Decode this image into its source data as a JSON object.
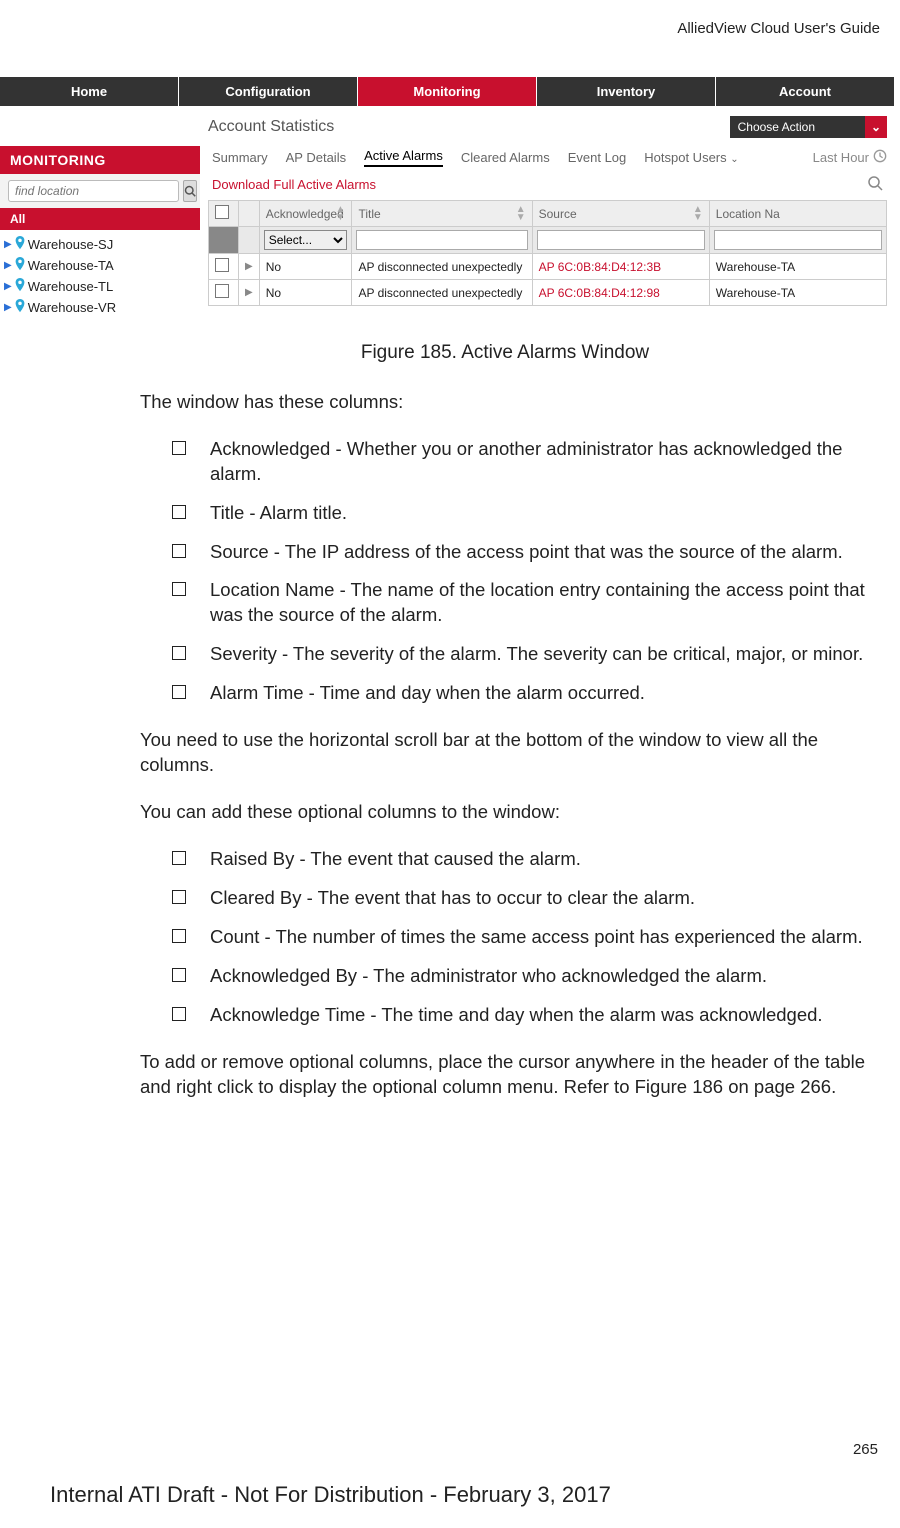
{
  "running_header": "AlliedView Cloud User's Guide",
  "ui": {
    "nav": {
      "home": "Home",
      "config": "Configuration",
      "monitoring": "Monitoring",
      "inventory": "Inventory",
      "account": "Account"
    },
    "acct_stats": "Account Statistics",
    "choose_action": "Choose Action",
    "left_panel": {
      "header": "MONITORING",
      "find_placeholder": "find location",
      "all_label": "All",
      "tree": [
        "Warehouse-SJ",
        "Warehouse-TA",
        "Warehouse-TL",
        "Warehouse-VR"
      ]
    },
    "tabs": {
      "summary": "Summary",
      "ap": "AP Details",
      "active": "Active Alarms",
      "cleared": "Cleared Alarms",
      "event": "Event Log",
      "hotspot": "Hotspot Users",
      "last_hour": "Last Hour"
    },
    "download_link": "Download Full Active Alarms",
    "table": {
      "hdr_ack": "Acknowledged",
      "hdr_title": "Title",
      "hdr_source": "Source",
      "hdr_loc": "Location Na",
      "filter_select": "Select...",
      "rows": [
        {
          "ack": "No",
          "title": "AP disconnected unexpectedly",
          "source": "AP 6C:0B:84:D4:12:3B",
          "loc": "Warehouse-TA"
        },
        {
          "ack": "No",
          "title": "AP disconnected unexpectedly",
          "source": "AP 6C:0B:84:D4:12:98",
          "loc": "Warehouse-TA"
        }
      ]
    }
  },
  "fig_caption": "Figure 185. Active Alarms Window",
  "doc": {
    "p1": "The window has these columns:",
    "cols": [
      "Acknowledged - Whether you or another administrator has acknowledged the alarm.",
      "Title - Alarm title.",
      "Source - The IP address of the access point that was the source of the alarm.",
      "Location Name - The name of the location entry containing the access point that was the source of the alarm.",
      "Severity - The severity of the alarm. The severity can be critical, major, or minor.",
      "Alarm Time - Time and day when the alarm occurred."
    ],
    "p2": "You need to use the horizontal scroll bar at the bottom of the window to view all the columns.",
    "p3": "You can add these optional columns to the window:",
    "opts": [
      "Raised By - The event that caused the alarm.",
      "Cleared By - The event that has to occur to clear the alarm.",
      "Count - The number of times the same access point has experienced the alarm.",
      "Acknowledged By - The administrator who acknowledged the alarm.",
      "Acknowledge Time - The time and day when the alarm was acknowledged."
    ],
    "p4": "To add or remove optional columns, place the cursor anywhere in the header of the table and right click to display the optional column menu. Refer to Figure 186 on page 266."
  },
  "page_number": "265",
  "footer": "Internal ATI Draft - Not For Distribution - February 3, 2017"
}
